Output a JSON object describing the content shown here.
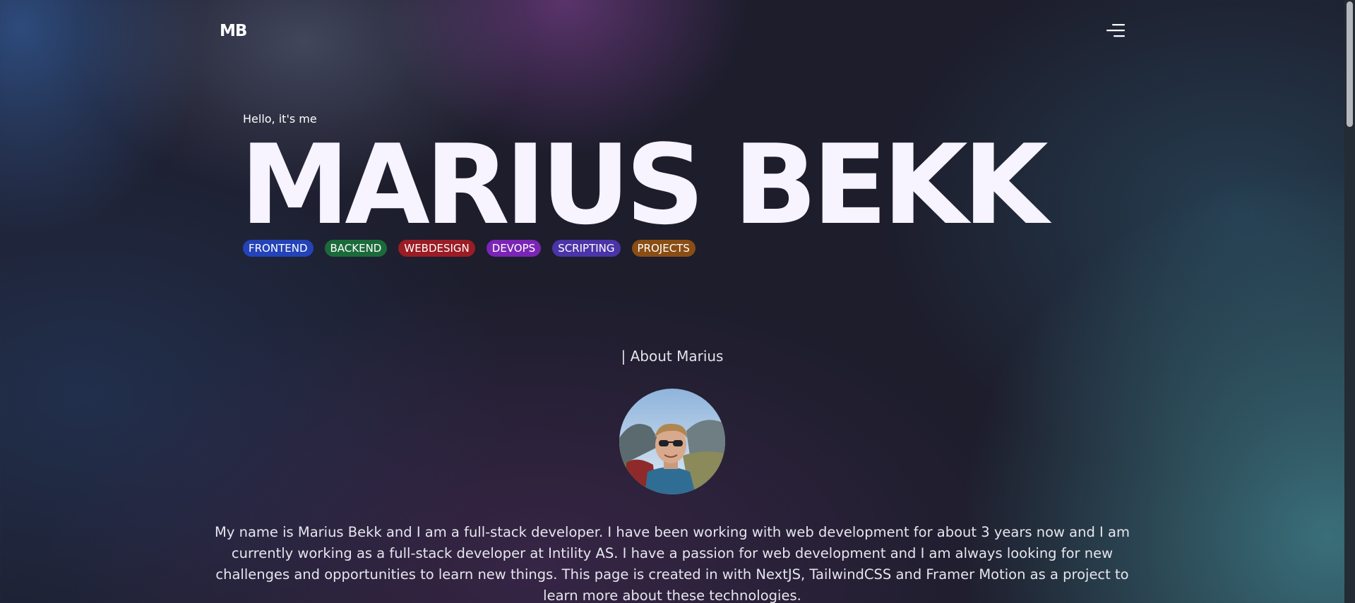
{
  "header": {
    "logo": "MB",
    "menu_icon": "menu-icon"
  },
  "hero": {
    "greeting": "Hello, it's me",
    "name": "MARIUS BEKK",
    "tags": [
      {
        "label": "FRONTEND",
        "color": "#2443b8"
      },
      {
        "label": "BACKEND",
        "color": "#1b6b3a"
      },
      {
        "label": "WEBDESIGN",
        "color": "#9b1c24"
      },
      {
        "label": "DEVOPS",
        "color": "#7a25b6"
      },
      {
        "label": "SCRIPTING",
        "color": "#4a34a8"
      },
      {
        "label": "PROJECTS",
        "color": "#8a4d14"
      }
    ]
  },
  "about": {
    "heading": "| About Marius",
    "avatar_icon": "profile-photo",
    "text": "My name is Marius Bekk and I am a full-stack developer. I have been working with web development for about 3 years now and I am currently working as a full-stack developer at Intility AS. I have a passion for web development and I am always looking for new challenges and opportunities to learn new things. This page is created in with NextJS, TailwindCSS and Framer Motion as a project to learn more about these technologies."
  }
}
